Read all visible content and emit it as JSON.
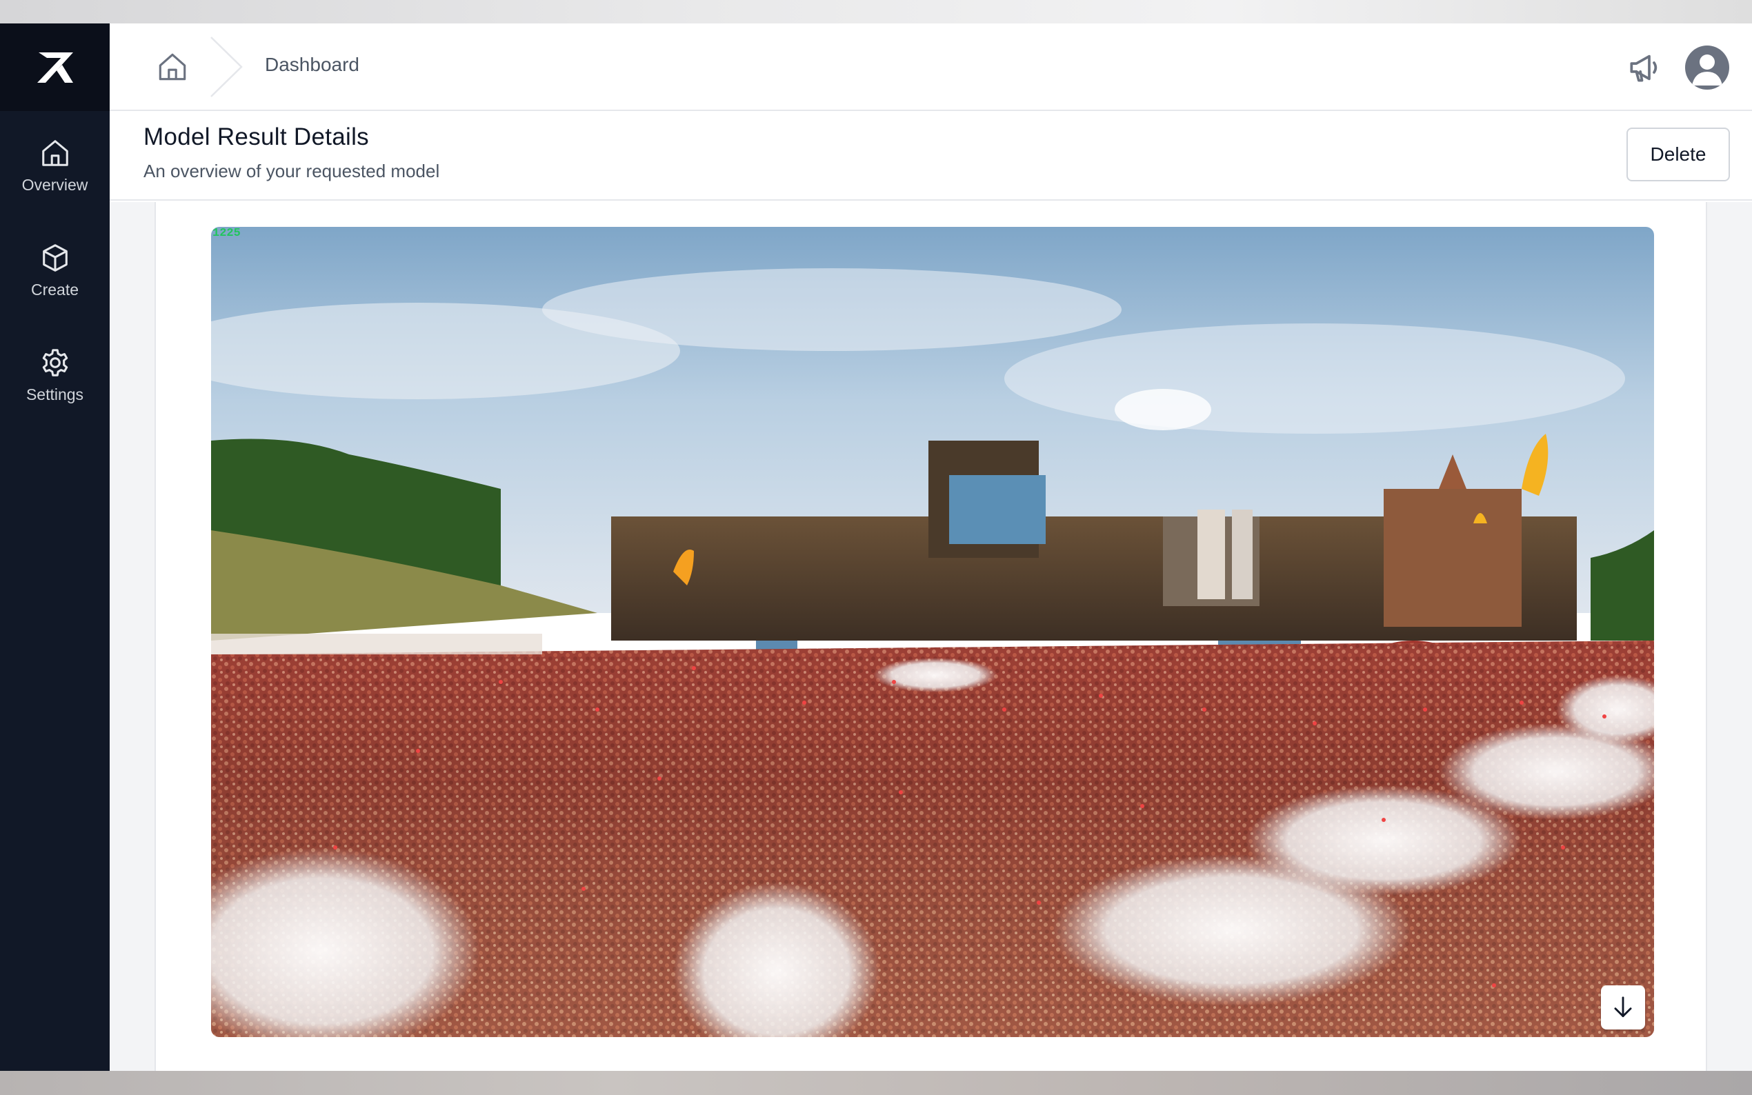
{
  "brand": {
    "logo_icon": "x-logo-icon"
  },
  "sidebar": {
    "items": [
      {
        "label": "Overview",
        "icon": "home-icon"
      },
      {
        "label": "Create",
        "icon": "cube-icon"
      },
      {
        "label": "Settings",
        "icon": "gear-icon"
      }
    ]
  },
  "topbar": {
    "breadcrumb": {
      "home_icon": "home-icon",
      "current": "Dashboard"
    },
    "announce_icon": "megaphone-icon",
    "avatar_icon": "user-avatar-icon"
  },
  "page": {
    "title": "Model Result Details",
    "subtitle": "An overview of your requested model",
    "delete_label": "Delete"
  },
  "result": {
    "count_label": "1225",
    "image_description": "festival-crowd-image",
    "download_icon": "arrow-down-icon"
  },
  "colors": {
    "sidebar_bg": "#111827",
    "count_label_color": "#22c55e",
    "detection_dot_color": "#ef4444"
  }
}
